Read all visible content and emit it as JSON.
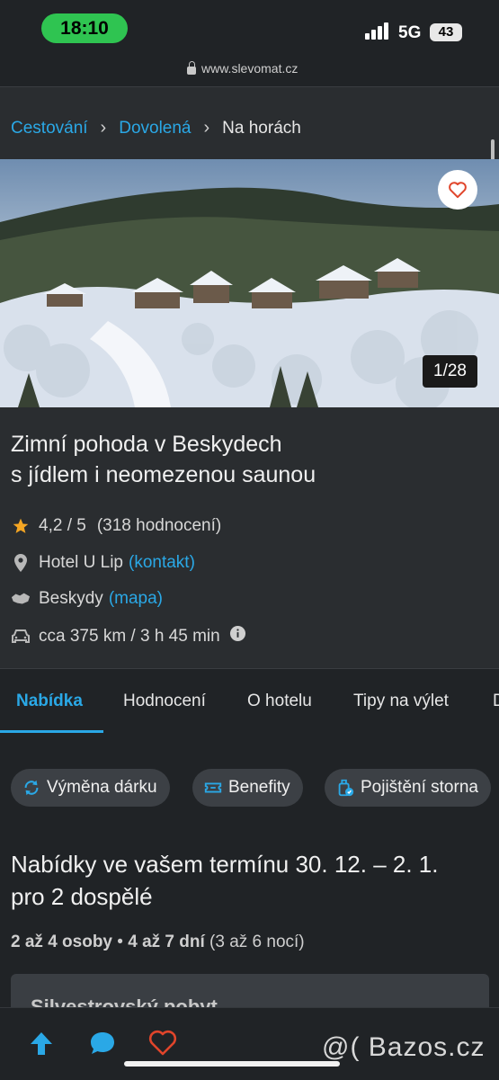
{
  "status_bar": {
    "time": "18:10",
    "network": "5G",
    "battery": "43"
  },
  "browser": {
    "url": "www.slevomat.cz"
  },
  "breadcrumb": {
    "items": [
      "Cestování",
      "Dovolená"
    ],
    "current": "Na horách"
  },
  "hero": {
    "counter": "1/28"
  },
  "listing": {
    "title_line1": "Zimní pohoda v Beskydech",
    "title_line2": "s jídlem i neomezenou saunou",
    "rating": "4,2 / 5",
    "reviews": "(318 hodnocení)",
    "hotel": "Hotel U Lip",
    "hotel_link": "(kontakt)",
    "region": "Beskydy",
    "region_link": "(mapa)",
    "distance": "cca 375 km / 3 h 45 min"
  },
  "tabs": [
    {
      "label": "Nabídka",
      "active": true
    },
    {
      "label": "Hodnocení"
    },
    {
      "label": "O hotelu"
    },
    {
      "label": "Tipy na výlet"
    },
    {
      "label": "D"
    }
  ],
  "chips": [
    "Výměna dárku",
    "Benefity",
    "Pojištění storna"
  ],
  "offers": {
    "title_line1": "Nabídky ve vašem termínu 30. 12. – 2. 1.",
    "title_line2": "pro 2 dospělé",
    "persons": "2 až 4 osoby",
    "separator": "•",
    "days": "4 až 7 dní",
    "nights": "(3 až 6 nocí)",
    "card_title": "Silvestrovský pobyt"
  },
  "watermark": "@( Bazos.cz",
  "colors": {
    "accent": "#2aa8e6",
    "status_green": "#2fc451",
    "heart_red": "#e0452b",
    "star": "#f5a623"
  },
  "icons": [
    "lock-icon",
    "chevron-right-icon",
    "heart-icon",
    "star-icon",
    "location-pin-icon",
    "map-region-icon",
    "car-icon",
    "info-icon",
    "gift-swap-icon",
    "ticket-icon",
    "luggage-shield-icon",
    "arrow-up-icon",
    "chat-icon"
  ]
}
